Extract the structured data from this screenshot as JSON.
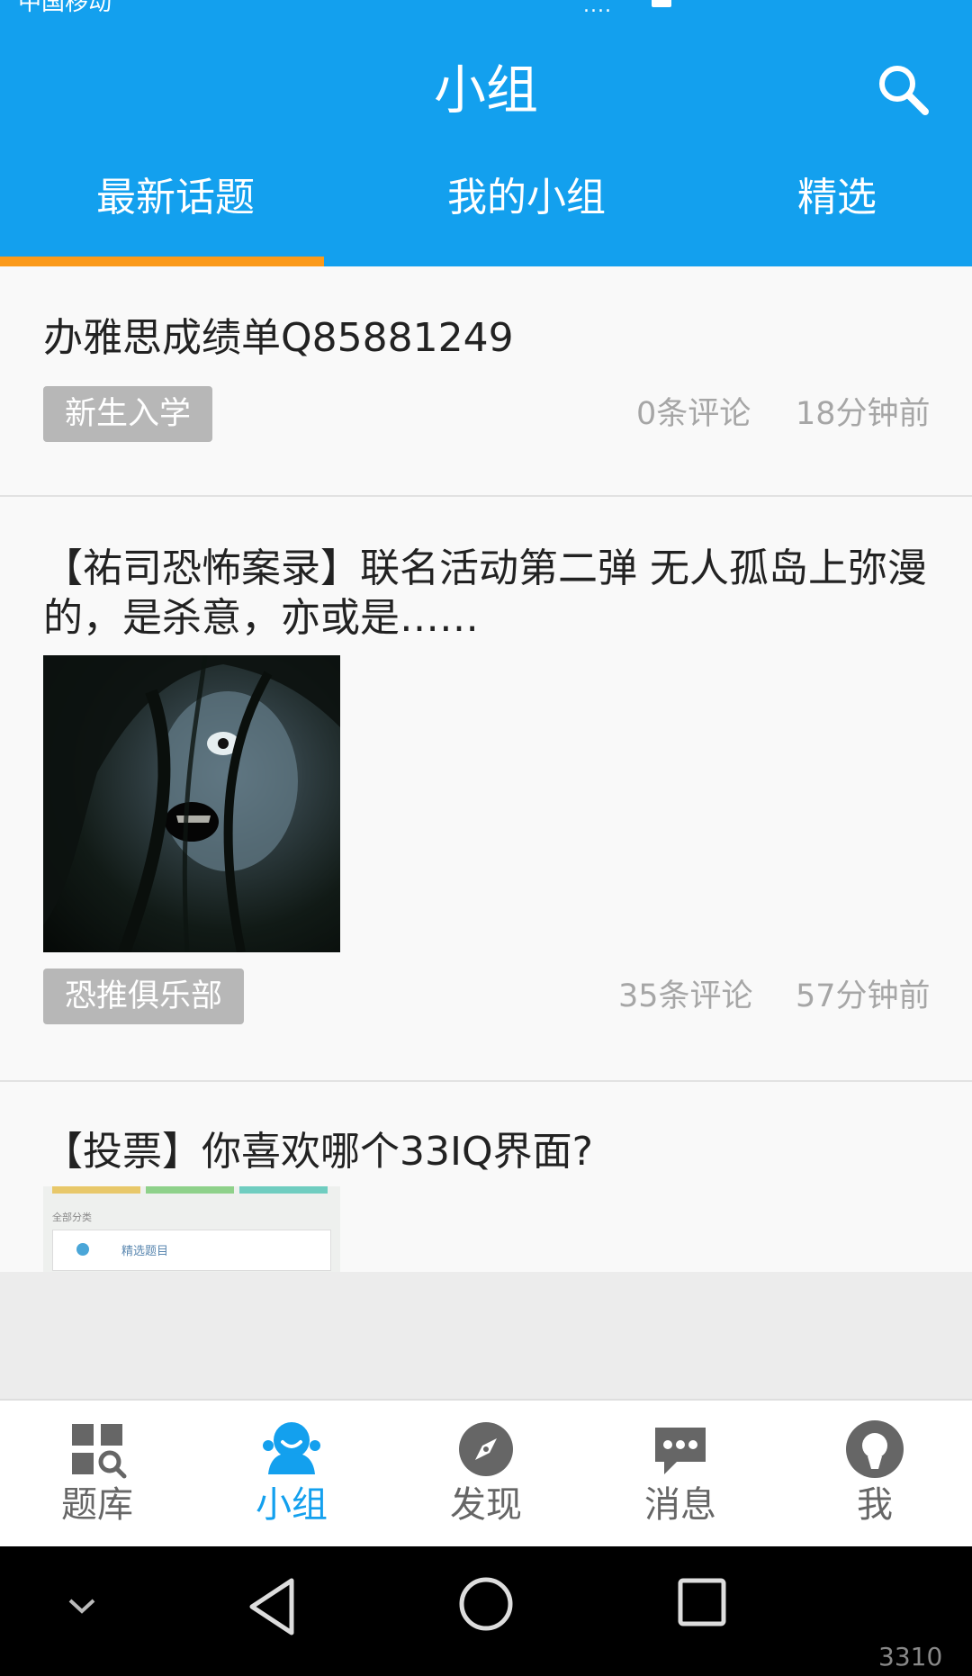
{
  "status_bar": {
    "carrier": "中国移动",
    "signal": "...."
  },
  "header": {
    "title": "小组",
    "tabs": [
      {
        "label": "最新话题",
        "active": true
      },
      {
        "label": "我的小组",
        "active": false
      },
      {
        "label": "精选",
        "active": false
      }
    ],
    "accent_color": "#13a0ee",
    "indicator_color": "#fb9a1b"
  },
  "feed": {
    "posts": [
      {
        "title": "办雅思成绩单Q85881249",
        "tag": "新生入学",
        "comments": "0条评论",
        "time": "18分钟前"
      },
      {
        "title": "【祐司恐怖案录】联名活动第二弹 无人孤岛上弥漫的，是杀意，亦或是……",
        "tag": "恐推俱乐部",
        "comments": "35条评论",
        "time": "57分钟前",
        "thumbnail": "horror-face-image"
      },
      {
        "title": "【投票】你喜欢哪个33IQ界面?",
        "thumbnail": "app-screenshot-image",
        "thumbnail_text": {
          "caption": "全部分类",
          "card_label": "精选题目"
        }
      }
    ]
  },
  "bottom_nav": {
    "items": [
      {
        "label": "题库",
        "icon": "grid-search-icon",
        "active": false
      },
      {
        "label": "小组",
        "icon": "group-person-icon",
        "active": true
      },
      {
        "label": "发现",
        "icon": "compass-icon",
        "active": false
      },
      {
        "label": "消息",
        "icon": "chat-bubble-icon",
        "active": false
      },
      {
        "label": "我",
        "icon": "user-icon",
        "active": false
      }
    ]
  },
  "watermark": "3310"
}
